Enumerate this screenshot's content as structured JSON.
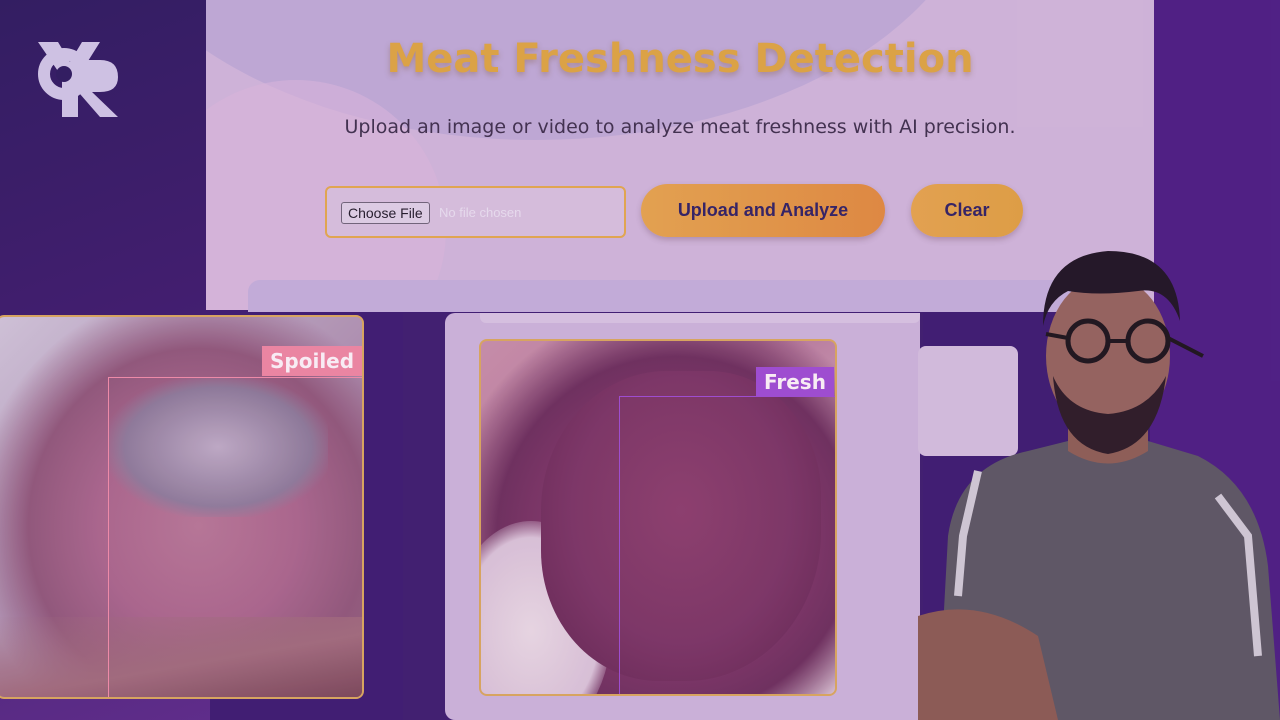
{
  "header": {
    "title": "Meat Freshness Detection",
    "subtitle": "Upload an image or video to analyze meat freshness with AI precision."
  },
  "upload": {
    "choose_file_label": "Choose File",
    "file_status": "No file chosen",
    "upload_button": "Upload and Analyze",
    "clear_button": "Clear"
  },
  "results": [
    {
      "label": "Spoiled",
      "color": "#ec86a0"
    },
    {
      "label": "Fresh",
      "color": "#9c4bd0"
    }
  ],
  "colors": {
    "accent": "#dda53f",
    "background": "#3a1a6e",
    "panel": "#cfb6d8"
  },
  "icons": {
    "logo": "brand-logo"
  }
}
